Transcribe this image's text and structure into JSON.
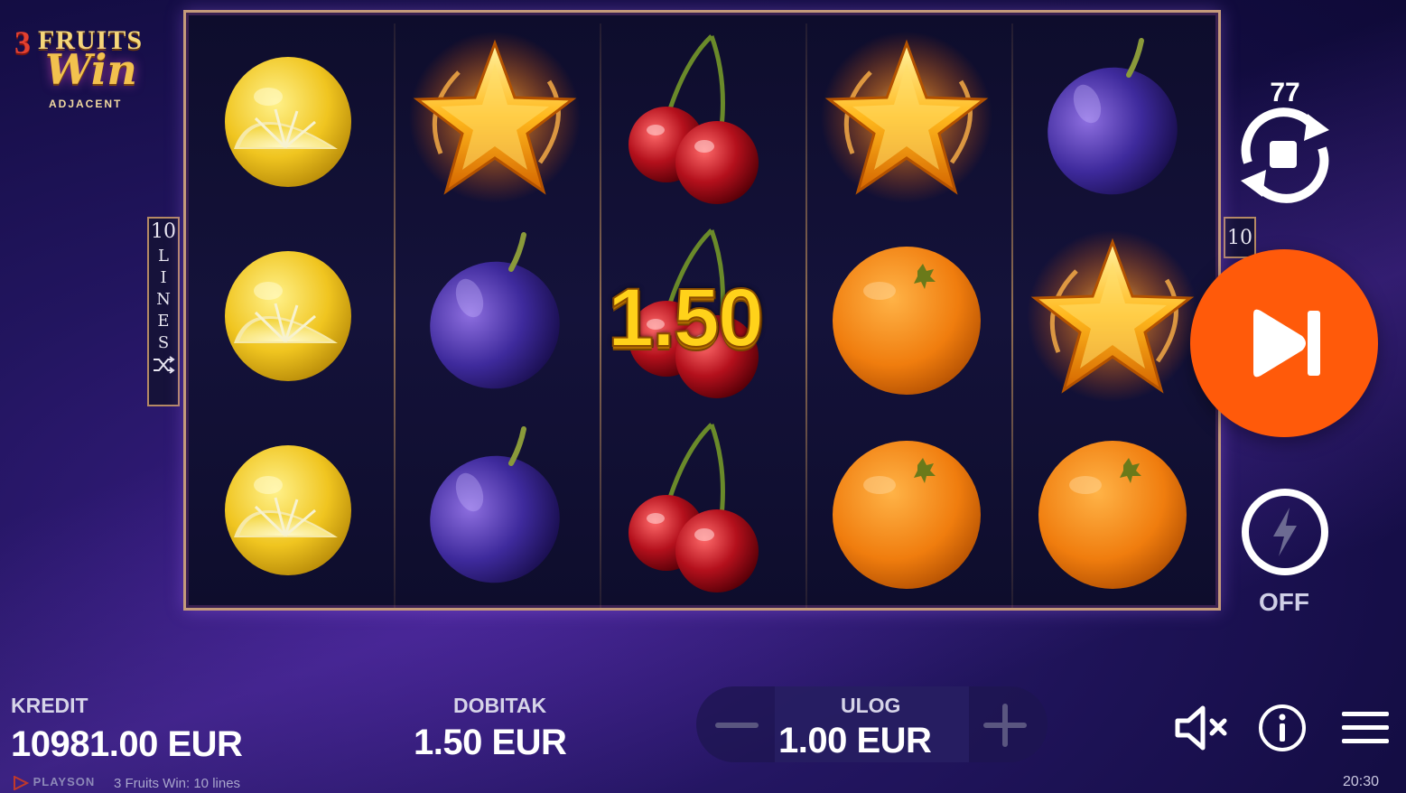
{
  "logo": {
    "number": "3",
    "fruits": "FRUITS",
    "win": "Win",
    "subtitle": "ADJACENT"
  },
  "reels": {
    "columns": [
      [
        "lemon",
        "lemon",
        "lemon"
      ],
      [
        "star",
        "plum",
        "plum"
      ],
      [
        "cherry",
        "cherry",
        "cherry"
      ],
      [
        "star",
        "orange",
        "orange"
      ],
      [
        "plum",
        "star",
        "orange"
      ]
    ],
    "win_amount": "1.50"
  },
  "lines": {
    "left_count": "10",
    "left_letters": [
      "L",
      "I",
      "N",
      "E",
      "S"
    ],
    "right_count": "10"
  },
  "controls": {
    "autoplay_count": "77",
    "turbo_state": "OFF"
  },
  "bottom": {
    "credit_label": "KREDIT",
    "credit_value": "10981.00 EUR",
    "win_label": "DOBITAK",
    "win_value": "1.50 EUR",
    "bet_label": "ULOG",
    "bet_value": "1.00 EUR"
  },
  "footer": {
    "brand": "PLAYSON",
    "game": "3 Fruits Win: 10 lines",
    "time": "20:30"
  },
  "colors": {
    "spin_button": "#ff5a0a",
    "win_text": "#ffd21a",
    "frame_border": "#c49a7a"
  }
}
